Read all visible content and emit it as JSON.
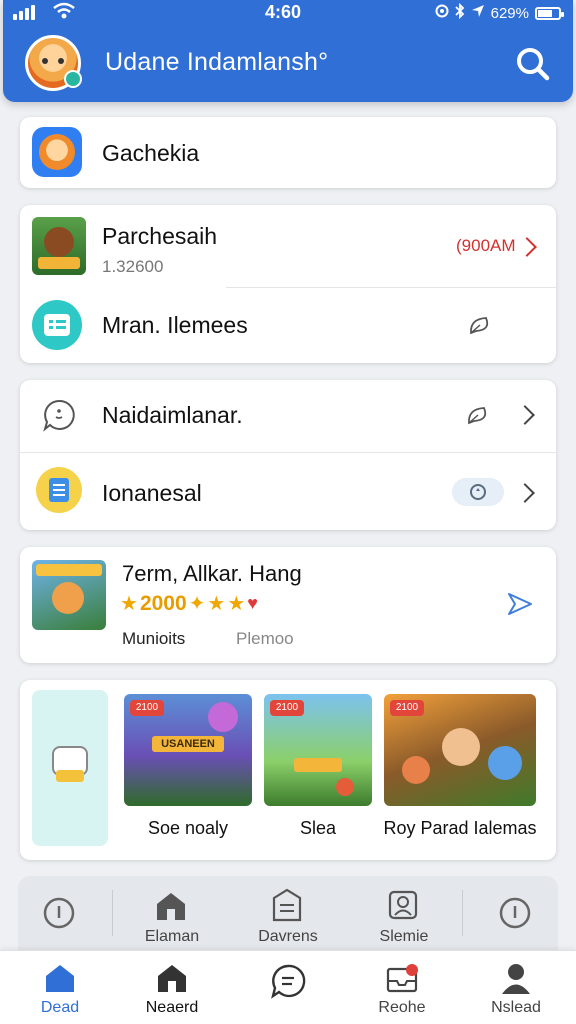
{
  "status_bar": {
    "time": "4:60",
    "battery": "629%"
  },
  "header": {
    "title": "Udane Indamlansh°",
    "avatar_icon": "cartoon-avatar-icon",
    "search_icon": "search-icon"
  },
  "colors": {
    "brand_blue": "#2f6fd6",
    "red_accent": "#d0322f",
    "star_gold": "#f0a800"
  },
  "section1": {
    "label": "Gachekia"
  },
  "section2": {
    "items": [
      {
        "label": "Parchesaih",
        "sub": "1.32600",
        "tag": "(900AM"
      },
      {
        "label": "Mran. Ilemees"
      }
    ]
  },
  "section3": {
    "items": [
      {
        "label": "Naidaimlanar."
      },
      {
        "label": "Ionanesal"
      }
    ]
  },
  "featured": {
    "title": "7erm, Allkar. Hang",
    "rating_text": "2000",
    "meta_left": "Munioits",
    "meta_right": "Plemoo"
  },
  "games": {
    "items": [
      {
        "caption": "Soe noaly",
        "banner": "USANEEN"
      },
      {
        "caption": "Slea"
      },
      {
        "caption": "Roy Parad Ialemas"
      }
    ]
  },
  "quickbar": {
    "items": [
      {
        "label": "Elaman"
      },
      {
        "label": "Davrens"
      },
      {
        "label": "Slemie"
      }
    ]
  },
  "bottom_nav": {
    "items": [
      {
        "label": "Dead",
        "icon": "home-icon",
        "active": true
      },
      {
        "label": "Neaerd",
        "icon": "house-icon"
      },
      {
        "label": "",
        "icon": "chat-icon"
      },
      {
        "label": "Reohe",
        "icon": "inbox-icon"
      },
      {
        "label": "Nslead",
        "icon": "profile-icon"
      }
    ]
  }
}
